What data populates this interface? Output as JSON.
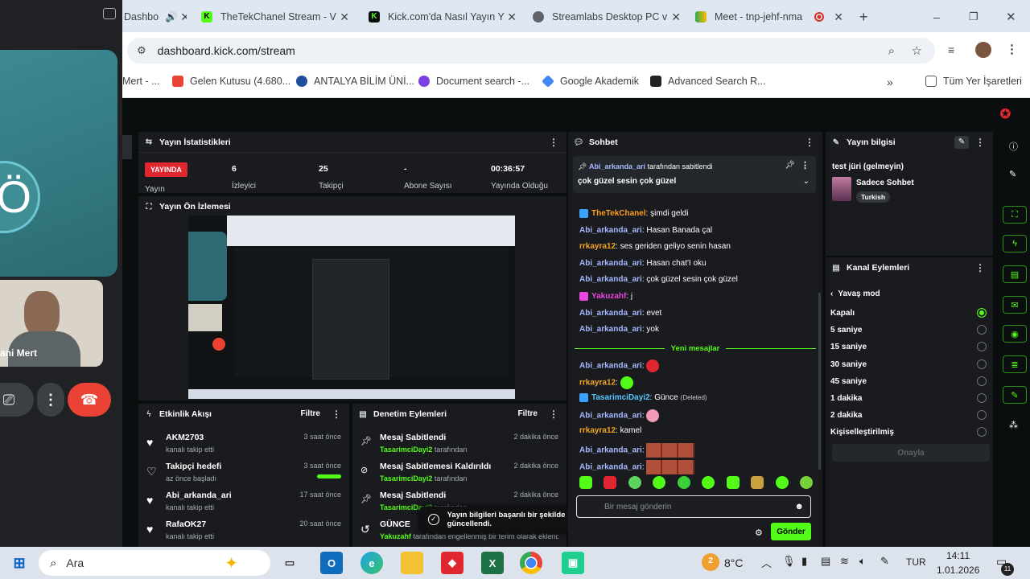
{
  "meet": {
    "name": "ani Mert",
    "initial": "Ö"
  },
  "tabs": [
    {
      "title": "Dashbo",
      "icon": "kick-icon"
    },
    {
      "title": "TheTekChanel Stream - V",
      "icon": "kick-icon"
    },
    {
      "title": "Kick.com'da Nasıl Yayın Y",
      "icon": "kick-icon"
    },
    {
      "title": "Streamlabs Desktop PC v",
      "icon": "globe-icon"
    },
    {
      "title": "Meet - tnp-jehf-nma",
      "icon": "meet-icon"
    }
  ],
  "window_controls": {
    "minimize": "–",
    "maximize": "❐",
    "close": "✕"
  },
  "address": {
    "url": "dashboard.kick.com/stream"
  },
  "bookmarks": [
    {
      "label": "Mert - ...",
      "color": "#6b8df0"
    },
    {
      "label": "Gelen Kutusu (4.680...",
      "color": "#ea4335"
    },
    {
      "label": "ANTALYA BİLİM ÜNİ...",
      "color": "#1f4e9c"
    },
    {
      "label": "Document search -...",
      "color": "#7b3fe4"
    },
    {
      "label": "Google Akademik",
      "color": "#4285f4"
    },
    {
      "label": "Advanced Search R...",
      "color": "#222222"
    }
  ],
  "all_bookmarks": "Tüm Yer İşaretleri",
  "stats": {
    "header": "Yayın İstatistikleri",
    "live_badge": "YAYINDA",
    "live_label": "Yayın",
    "viewers": "6",
    "viewers_label": "İzleyici",
    "followers": "25",
    "followers_label": "Takipçi",
    "subs": "-",
    "subs_label": "Abone Sayısı",
    "uptime": "00:36:57",
    "uptime_label": "Yayında Olduğu"
  },
  "preview": {
    "header": "Yayın Ön İzlemesi"
  },
  "activity": {
    "header": "Etkinlik Akışı",
    "filter": "Filtre",
    "items": [
      {
        "title": "AKM2703",
        "sub": "kanalı takip etti",
        "time": "3 saat önce",
        "icon": "heart-icon"
      },
      {
        "title": "Takipçi hedefi",
        "sub": "az önce başladı",
        "time": "3 saat önce",
        "icon": "heart-outline-icon"
      },
      {
        "title": "Abi_arkanda_ari",
        "sub": "kanalı takip etti",
        "time": "17 saat önce",
        "icon": "heart-icon"
      },
      {
        "title": "RafaOK27",
        "sub": "kanalı takip etti",
        "time": "20 saat önce",
        "icon": "heart-icon"
      }
    ]
  },
  "moderation": {
    "header": "Denetim Eylemleri",
    "filter": "Filtre",
    "items": [
      {
        "title": "Mesaj Sabitlendi",
        "user": "TasarimciDayi2",
        "suffix": "tarafından",
        "time": "2 dakika önce",
        "icon": "pin-icon"
      },
      {
        "title": "Mesaj Sabitlemesi Kaldırıldı",
        "user": "TasarimciDayi2",
        "suffix": "tarafından",
        "time": "2 dakika önce",
        "icon": "unpin-icon"
      },
      {
        "title": "Mesaj Sabitlendi",
        "user": "TasarimciDayi2",
        "suffix": "tarafından",
        "time": "2 dakika önce",
        "icon": "pin-icon"
      },
      {
        "title": "GÜNCE",
        "user": "Yakuzahf",
        "suffix": "tarafından engellenmiş bir terim olarak eklendi",
        "time": "",
        "icon": "undo-icon"
      }
    ]
  },
  "toast": "Yayın bilgileri başarılı bir şekilde güncellendi.",
  "chat": {
    "header": "Sohbet",
    "pinned_by_user": "Abi_arkanda_ari",
    "pinned_by_suffix": "tarafından sabitlendi",
    "pinned_text": "çok güzel sesin çok güzel",
    "messages": [
      {
        "user": "TheTekChanel",
        "text": "şimdi geldi",
        "color": "#ff9e1f",
        "badge": "broadcaster"
      },
      {
        "user": "Abi_arkanda_ari",
        "text": "Hasan Banada çal",
        "color": "#a6b8ff"
      },
      {
        "user": "rrkayra12",
        "text": "ses geriden geliyo senin hasan",
        "color": "#f5a623"
      },
      {
        "user": "Abi_arkanda_ari",
        "text": "Hasan chat'I oku",
        "color": "#a6b8ff"
      },
      {
        "user": "Abi_arkanda_ari",
        "text": "çok güzel sesin çok güzel",
        "color": "#a6b8ff"
      },
      {
        "user": "Yakuzahf",
        "text": "j",
        "color": "#e845e0",
        "badge": "mic"
      },
      {
        "user": "Abi_arkanda_ari",
        "text": "evet",
        "color": "#a6b8ff"
      },
      {
        "user": "Abi_arkanda_ari",
        "text": "yok",
        "color": "#a6b8ff"
      }
    ],
    "new_messages": "Yeni mesajlar",
    "new": [
      {
        "user": "Abi_arkanda_ari",
        "text": "",
        "color": "#a6b8ff",
        "emote": "heart-emote"
      },
      {
        "user": "rrkayra12",
        "text": "",
        "color": "#f5a623",
        "emote": "green-emote"
      },
      {
        "user": "TasarimciDayi2",
        "text": "Günce",
        "deleted": "(Deleted)",
        "color": "#57c7ff",
        "badge": "mod"
      },
      {
        "user": "Abi_arkanda_ari",
        "text": "",
        "color": "#a6b8ff",
        "emote": "shrimp-emote"
      },
      {
        "user": "rrkayra12",
        "text": "kamel",
        "color": "#f5a623"
      },
      {
        "user": "Abi_arkanda_ari",
        "text": "",
        "color": "#a6b8ff",
        "emote": "face-emotes"
      },
      {
        "user": "Abi_arkanda_ari",
        "text": "",
        "color": "#a6b8ff",
        "emote": "face-emotes"
      }
    ],
    "placeholder": "Bir mesaj gönderin",
    "send": "Gönder"
  },
  "stream_info": {
    "header": "Yayın bilgisi",
    "title": "test jüri (gelmeyin)",
    "category": "Sadece Sohbet",
    "tag": "Turkish"
  },
  "channel_actions": {
    "header": "Kanal Eylemleri",
    "back": "Yavaş mod",
    "options": [
      "Kapalı",
      "5 saniye",
      "15 saniye",
      "30 saniye",
      "45 saniye",
      "1 dakika",
      "2 dakika",
      "Kişiselleştirilmiş"
    ],
    "selected": 0,
    "confirm": "Onayla"
  },
  "taskbar": {
    "search": "Ara",
    "weather": "8°C",
    "weather_badge": "2",
    "lang": "TUR",
    "time": "14:11",
    "date": "1.01.2026",
    "notif": "11"
  }
}
